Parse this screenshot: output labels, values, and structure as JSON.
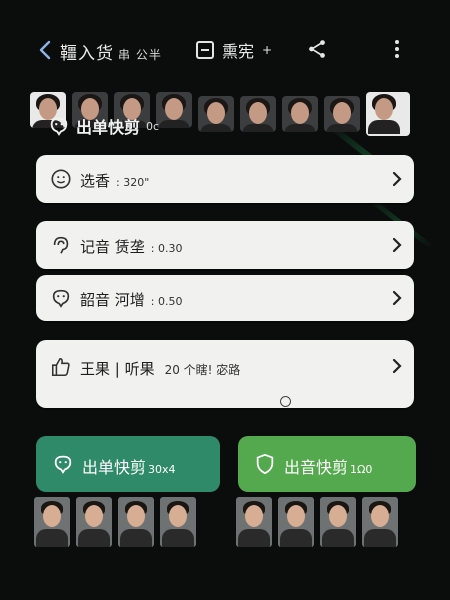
{
  "topbar": {
    "title": "韁入货",
    "title_small": "串 公半",
    "tab2_label": "熏宪",
    "tab2_small": "+"
  },
  "header_label": {
    "text": "出单快剪",
    "small": "0c"
  },
  "cards": [
    {
      "label": "选香",
      "value": ": 320\""
    },
    {
      "label": "记音 赁垄",
      "value": ": 0.30"
    },
    {
      "label": "韶音 河增",
      "value": ": 0.50"
    },
    {
      "label": "王果 | 听果",
      "value": "20   个瞎! 宓路"
    }
  ],
  "buttons": [
    {
      "label": "出单快剪",
      "small": "30x4",
      "color": "#2e8a68"
    },
    {
      "label": "出音快剪",
      "small": "1Ω0",
      "color": "#54a84d"
    }
  ],
  "colors": {
    "card_bg": "#f1f1f0",
    "btn_teal": "#2e8a68",
    "btn_green": "#54a84d",
    "bg": "#0b0c0c"
  },
  "icons": {
    "back": "chevron-left-icon",
    "tab2": "minus-square-icon",
    "share": "share-icon",
    "more": "more-vertical-icon",
    "card1": "smile-icon",
    "card2": "audio-icon",
    "card3": "mascot-icon",
    "card4": "thumbs-up-icon",
    "btn1": "mascot-icon",
    "btn2": "shield-icon",
    "chevron": "chevron-right-icon"
  }
}
